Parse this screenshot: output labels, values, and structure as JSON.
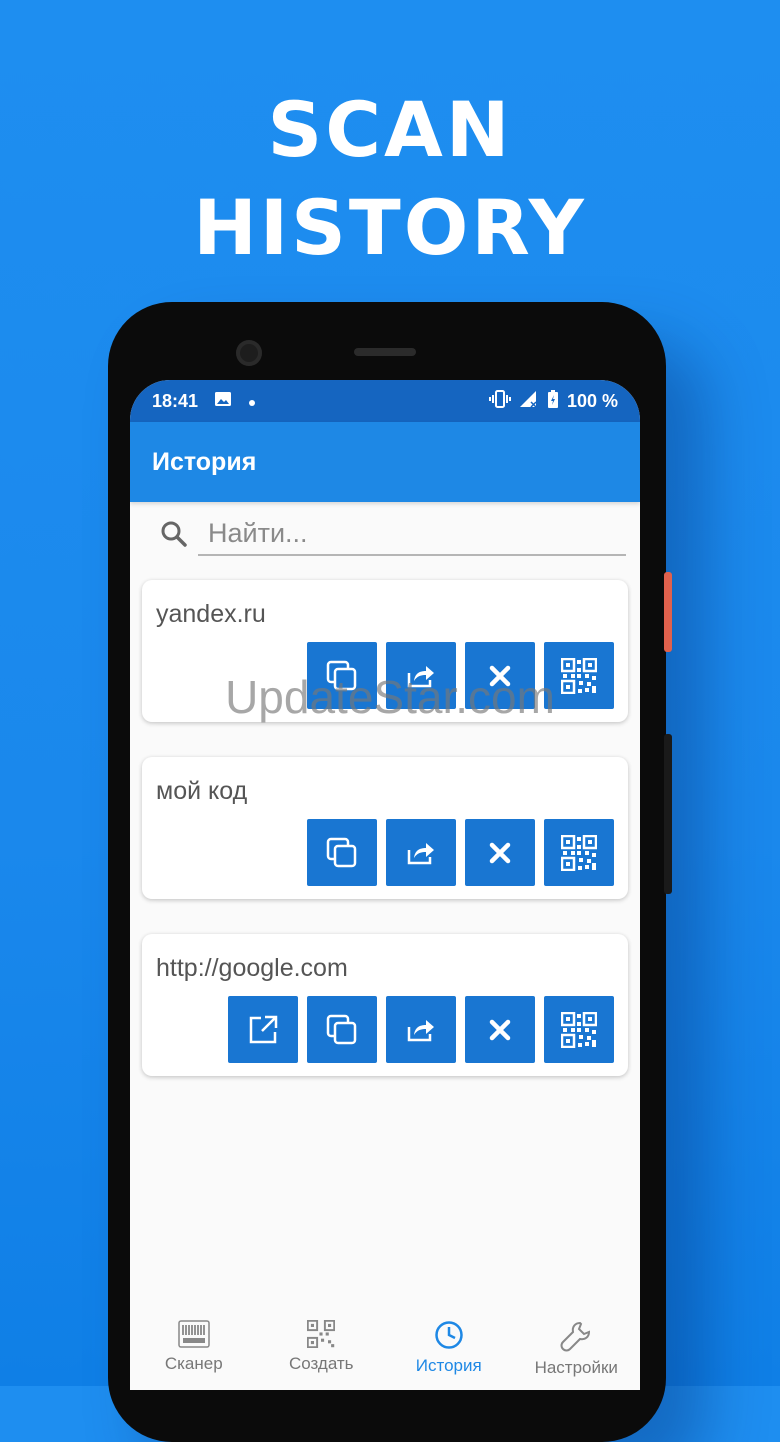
{
  "headline": {
    "line1": "SCAN",
    "line2": "HISTORY"
  },
  "status_bar": {
    "time": "18:41",
    "battery": "100 %"
  },
  "app_bar": {
    "title": "История"
  },
  "search": {
    "placeholder": "Найти...",
    "value": ""
  },
  "history_items": [
    {
      "text": "yandex.ru",
      "actions": [
        "copy",
        "share",
        "delete",
        "qr"
      ]
    },
    {
      "text": "мой код",
      "actions": [
        "copy",
        "share",
        "delete",
        "qr"
      ]
    },
    {
      "text": "http://google.com",
      "actions": [
        "open-link",
        "copy",
        "share",
        "delete",
        "qr"
      ]
    }
  ],
  "watermark": "UpdateStar.com",
  "bottom_nav": [
    {
      "label": "Сканер",
      "icon": "barcode-icon",
      "active": false
    },
    {
      "label": "Создать",
      "icon": "qr-code-icon",
      "active": false
    },
    {
      "label": "История",
      "icon": "clock-icon",
      "active": true
    },
    {
      "label": "Настройки",
      "icon": "wrench-icon",
      "active": false
    }
  ],
  "colors": {
    "background": "#1e8ef0",
    "status_bar": "#1565c0",
    "app_bar": "#1e88e5",
    "action_button": "#1976d2",
    "nav_active": "#1e88e5"
  }
}
